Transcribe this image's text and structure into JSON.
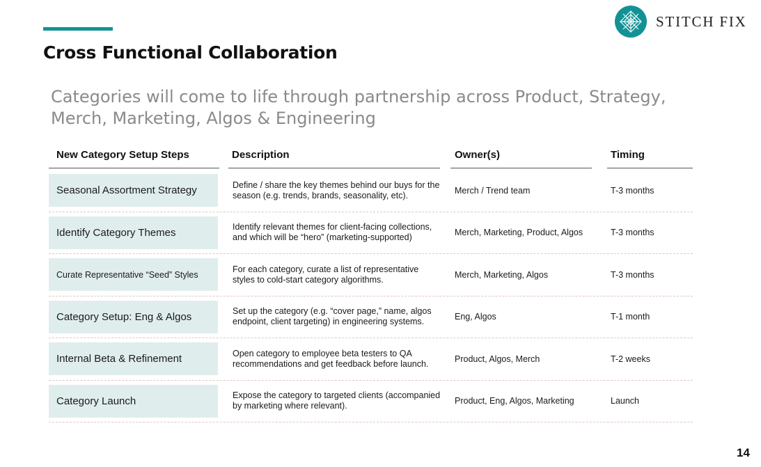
{
  "title": "Cross Functional Collaboration",
  "subtitle": "Categories will come to life through partnership across Product, Strategy, Merch, Marketing, Algos & Engineering",
  "logo": {
    "text": "STITCH FIX",
    "icon": "stitch-fix-logo-mark",
    "color": "#139296"
  },
  "accent_color": "#139296",
  "table": {
    "headers": {
      "steps": "New Category Setup Steps",
      "description": "Description",
      "owners": "Owner(s)",
      "timing": "Timing"
    },
    "rows": [
      {
        "step": "Seasonal Assortment Strategy",
        "description": "Define / share the key themes behind our buys for the season (e.g. trends, brands, seasonality, etc).",
        "owners": "Merch / Trend team",
        "timing": "T-3 months"
      },
      {
        "step": "Identify Category Themes",
        "description": "Identify relevant themes for client-facing collections, and which will be “hero” (marketing-supported)",
        "owners": "Merch, Marketing, Product, Algos",
        "timing": "T-3 months"
      },
      {
        "step": "Curate Representative “Seed” Styles",
        "description": "For each category, curate a list of representative styles to cold-start category algorithms.",
        "owners": "Merch, Marketing, Algos",
        "timing": "T-3 months"
      },
      {
        "step": "Category Setup: Eng & Algos",
        "description": "Set up the category (e.g. “cover page,” name, algos endpoint, client targeting) in engineering systems.",
        "owners": "Eng, Algos",
        "timing": "T-1 month"
      },
      {
        "step": "Internal Beta & Refinement",
        "description": "Open category to employee beta testers to QA recommendations and get feedback before launch.",
        "owners": "Product, Algos, Merch",
        "timing": "T-2 weeks"
      },
      {
        "step": "Category Launch",
        "description": "Expose the category to targeted clients (accompanied by marketing where relevant).",
        "owners": "Product, Eng, Algos, Marketing",
        "timing": "Launch"
      }
    ]
  },
  "page_number": "14"
}
